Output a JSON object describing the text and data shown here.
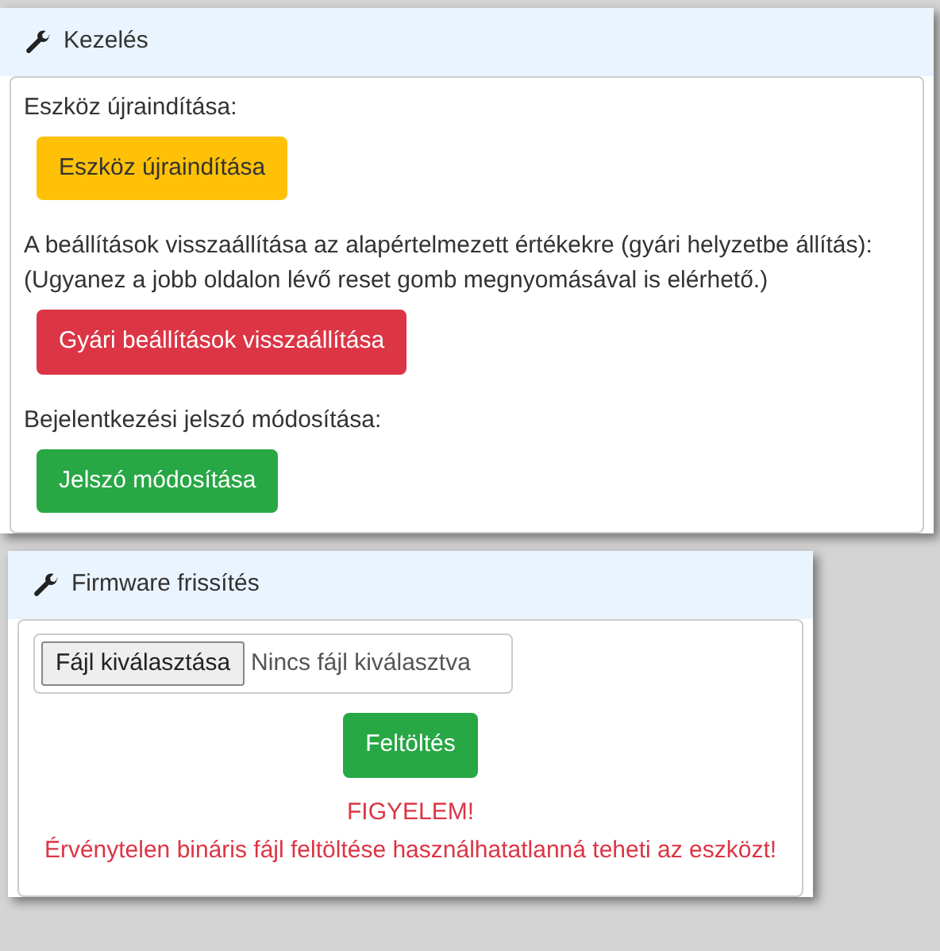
{
  "panels": [
    {
      "title": "Kezelés",
      "sections": [
        {
          "lines": [
            "Eszköz újraindítása:"
          ],
          "button": {
            "label": "Eszköz újraindítása",
            "kind": "caution"
          }
        },
        {
          "lines": [
            "A beállítások visszaállítása az alapértelmezett értékekre (gyári helyzetbe állítás):",
            "(Ugyanez a jobb oldalon lévő reset gomb megnyomásával is elérhető.)"
          ],
          "button": {
            "label": "Gyári beállítások visszaállítása",
            "kind": "destructive"
          }
        },
        {
          "lines": [
            "Bejelentkezési jelszó módosítása:"
          ],
          "button": {
            "label": "Jelszó módosítása",
            "kind": "confirm"
          }
        }
      ]
    },
    {
      "title": "Firmware frissítés",
      "file": {
        "button": "Fájl kiválasztása",
        "status": "Nincs fájl kiválasztva"
      },
      "upload": {
        "label": "Feltöltés",
        "kind": "confirm"
      },
      "warnings": [
        "FIGYELEM!",
        "Érvénytelen bináris fájl feltöltése használhatatlanná teheti az eszközt!"
      ]
    }
  ]
}
